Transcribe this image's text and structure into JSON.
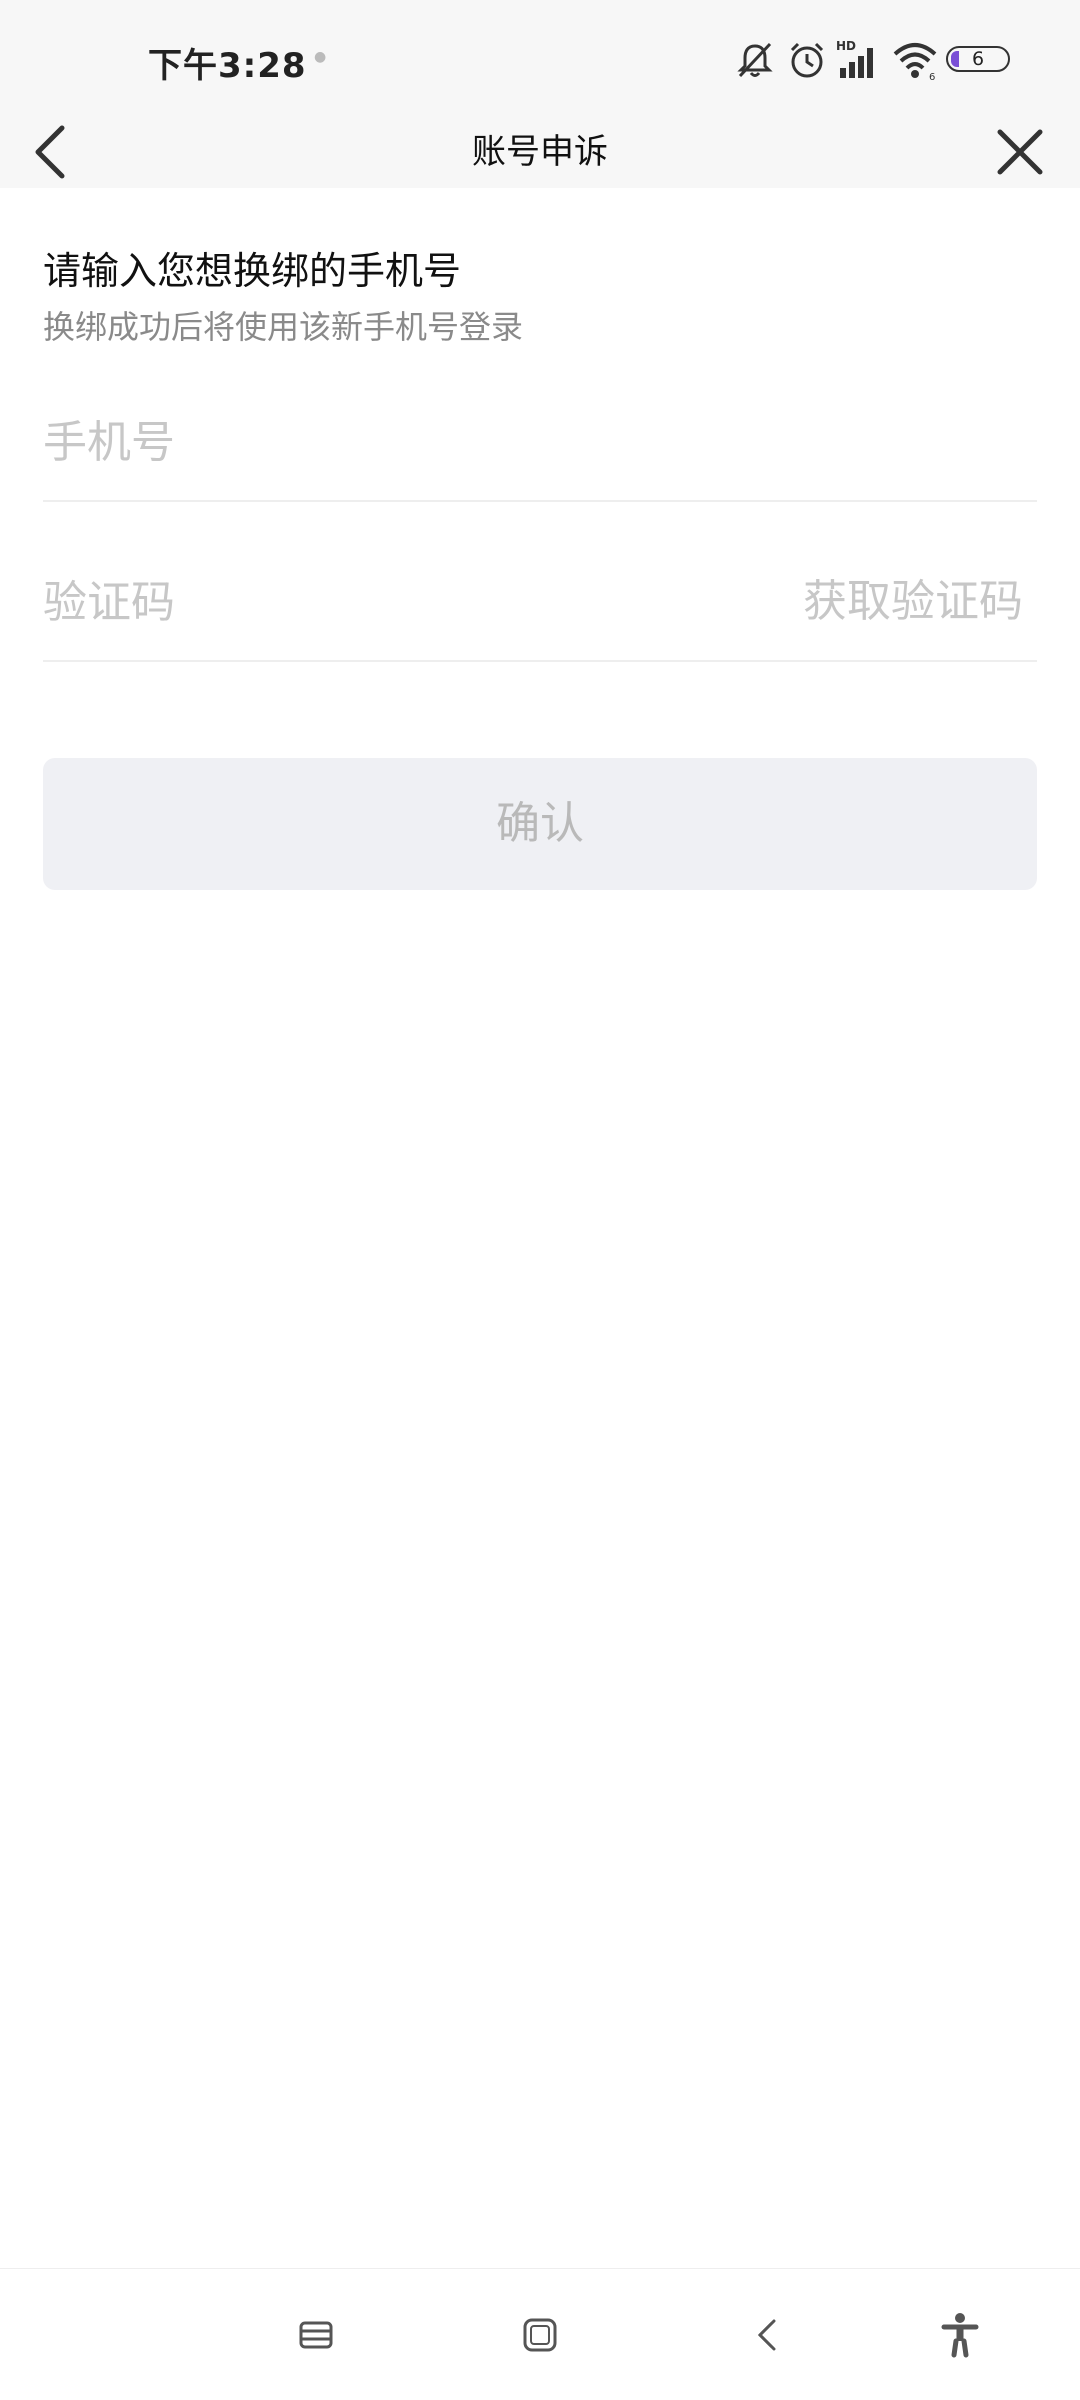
{
  "status_bar": {
    "time": "下午3:28",
    "icons": [
      "notification-dot-icon",
      "mute-bell-icon",
      "alarm-icon",
      "hd-signal-icon",
      "wifi-icon",
      "battery-icon"
    ],
    "battery_level": "6",
    "accent_color": "#7a4fd6"
  },
  "header": {
    "title": "账号申诉",
    "back_icon": "chevron-left-icon",
    "close_icon": "close-icon"
  },
  "form": {
    "heading": "请输入您想换绑的手机号",
    "subheading": "换绑成功后将使用该新手机号登录",
    "phone_placeholder": "手机号",
    "code_placeholder": "验证码",
    "get_code_label": "获取验证码",
    "confirm_label": "确认"
  },
  "nav_bar": {
    "icons": [
      "menu-icon",
      "home-icon",
      "back-icon",
      "accessibility-icon"
    ]
  }
}
